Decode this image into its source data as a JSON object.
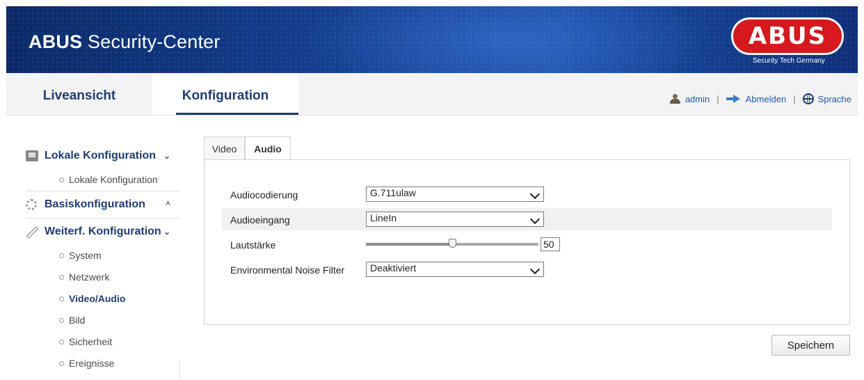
{
  "header": {
    "app_title_bold": "ABUS",
    "app_title_rest": " Security-Center",
    "logo_word": "ABUS",
    "logo_tagline": "Security Tech Germany"
  },
  "nav": {
    "tabs": [
      {
        "label": "Liveansicht",
        "active": false
      },
      {
        "label": "Konfiguration",
        "active": true
      }
    ],
    "user": "admin",
    "logout": "Abmelden",
    "language": "Sprache",
    "separator": "|"
  },
  "sidebar": {
    "sections": [
      {
        "label": "Lokale Konfiguration",
        "chevron": "⌄",
        "icon": "local-config-icon",
        "items": [
          {
            "label": "Lokale Konfiguration"
          }
        ]
      },
      {
        "label": "Basiskonfiguration",
        "chevron": "^",
        "icon": "gear-icon",
        "items": []
      },
      {
        "label": "Weiterf. Konfiguration",
        "chevron": "⌄",
        "icon": "wrench-icon",
        "items": [
          {
            "label": "System"
          },
          {
            "label": "Netzwerk"
          },
          {
            "label": "Video/Audio",
            "active": true
          },
          {
            "label": "Bild"
          },
          {
            "label": "Sicherheit"
          },
          {
            "label": "Ereignisse"
          }
        ]
      }
    ]
  },
  "content": {
    "tabs": [
      {
        "label": "Video",
        "active": false
      },
      {
        "label": "Audio",
        "active": true
      }
    ],
    "fields": {
      "codec": {
        "label": "Audiocodierung",
        "value": "G.711ulaw"
      },
      "input": {
        "label": "Audioeingang",
        "value": "LineIn"
      },
      "volume": {
        "label": "Lautstärke",
        "value": "50",
        "fraction": 0.5
      },
      "noise": {
        "label": "Environmental Noise Filter",
        "value": "Deaktiviert"
      }
    },
    "save_label": "Speichern"
  },
  "colors": {
    "nav_text": "#1f3c73",
    "link_text": "#1f5aa6",
    "banner": "#143d8c",
    "logo_red": "#d5191f"
  }
}
